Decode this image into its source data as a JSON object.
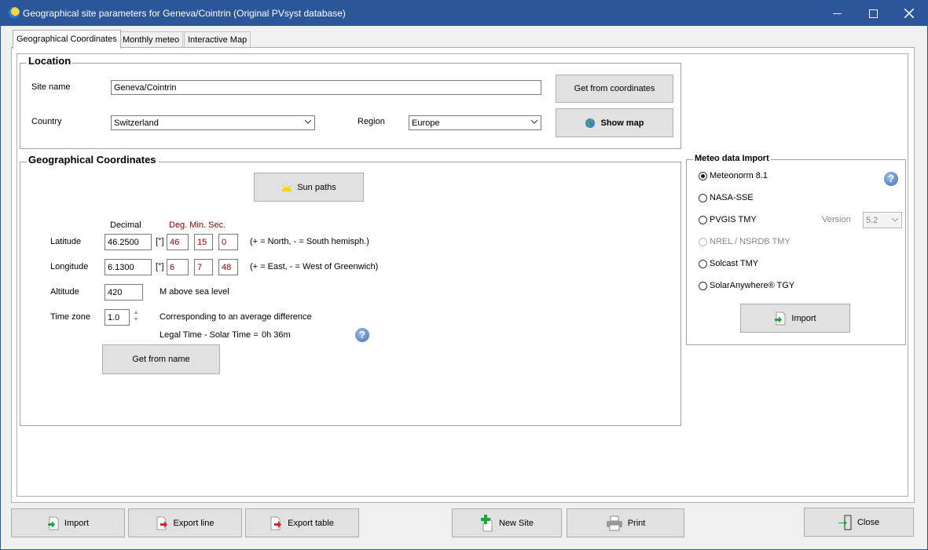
{
  "window": {
    "title": "Geographical site parameters for Geneva/Cointrin (Original PVsyst database)"
  },
  "tabs": [
    "Geographical Coordinates",
    "Monthly meteo",
    "Interactive Map"
  ],
  "location": {
    "title": "Location",
    "site_name_label": "Site name",
    "site_name_value": "Geneva/Cointrin",
    "country_label": "Country",
    "country_value": "Switzerland",
    "region_label": "Region",
    "region_value": "Europe",
    "get_from_coordinates": "Get from coordinates",
    "show_map": "Show map"
  },
  "coords": {
    "title": "Geographical Coordinates",
    "sun_paths": "Sun paths",
    "decimal_header": "Decimal",
    "dms_header": "Deg. Min. Sec.",
    "latitude_label": "Latitude",
    "latitude_decimal": "46.2500",
    "deg_unit": "[°]",
    "latitude_deg": "46",
    "latitude_min": "15",
    "latitude_sec": "0",
    "latitude_note": "(+ = North, - = South hemisph.)",
    "longitude_label": "Longitude",
    "longitude_decimal": "6.1300",
    "longitude_deg": "6",
    "longitude_min": "7",
    "longitude_sec": "48",
    "longitude_note": "(+ = East, - = West of Greenwich)",
    "altitude_label": "Altitude",
    "altitude_value": "420",
    "altitude_note": "M above sea level",
    "timezone_label": "Time zone",
    "timezone_value": "1.0",
    "timezone_note": "Corresponding to an average difference",
    "legal_time_label": "Legal Time - Solar Time =",
    "legal_time_value": "0h 36m",
    "get_from_name": "Get from name"
  },
  "meteo": {
    "title": "Meteo data Import",
    "options": [
      "Meteonorm 8.1",
      "NASA-SSE",
      "PVGIS TMY",
      "NREL / NSRDB TMY",
      "Solcast TMY",
      "SolarAnywhere® TGY"
    ],
    "selected": "Meteonorm 8.1",
    "version_label": "Version",
    "version_value": "5.2",
    "import_label": "Import"
  },
  "bottom": {
    "import": "Import",
    "export_line": "Export line",
    "export_table": "Export table",
    "new_site": "New Site",
    "print": "Print",
    "close": "Close"
  }
}
